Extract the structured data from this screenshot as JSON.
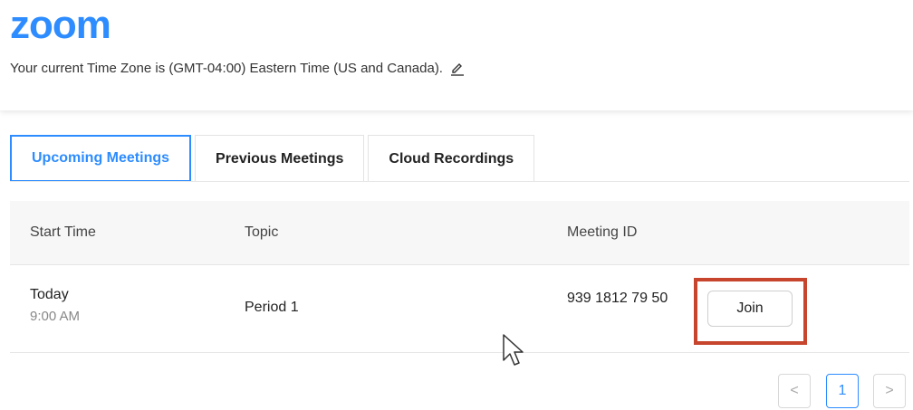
{
  "brand": {
    "logo_text": "zoom",
    "color": "#2d8cff"
  },
  "timezone": {
    "text": "Your current Time Zone is (GMT-04:00) Eastern Time (US and Canada).",
    "edit_icon": "pencil-icon"
  },
  "tabs": [
    {
      "label": "Upcoming Meetings",
      "active": true
    },
    {
      "label": "Previous Meetings",
      "active": false
    },
    {
      "label": "Cloud Recordings",
      "active": false
    }
  ],
  "table": {
    "headers": {
      "start_time": "Start Time",
      "topic": "Topic",
      "meeting_id": "Meeting ID"
    },
    "rows": [
      {
        "day": "Today",
        "time": "9:00 AM",
        "topic": "Period 1",
        "meeting_id": "939 1812 79 50",
        "action": "Join"
      }
    ]
  },
  "pagination": {
    "prev": "<",
    "current": "1",
    "next": ">"
  },
  "colors": {
    "accent": "#2d8cff",
    "highlight_box": "#c6452c"
  }
}
